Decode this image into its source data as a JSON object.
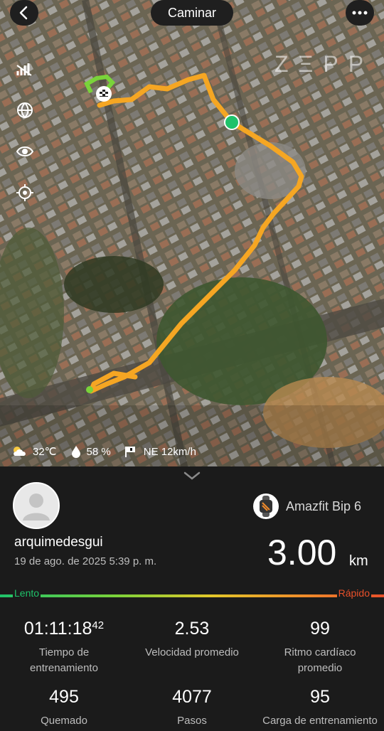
{
  "header": {
    "title": "Caminar",
    "back_icon": "chevron-left-icon",
    "more_icon": "more-dots-icon"
  },
  "map": {
    "watermark": "ZΞPP",
    "side_tools": [
      "signal-off-icon",
      "globe-icon",
      "eye-icon",
      "locate-icon"
    ],
    "route_color": "#f5a623",
    "weather": {
      "temperature": "32℃",
      "humidity": "58 %",
      "wind": "NE 12km/h"
    }
  },
  "summary": {
    "username": "arquimedesgui",
    "date": "19 de ago. de 2025 5:39 p. m.",
    "device": "Amazfit Bip 6",
    "distance_value": "3.00",
    "distance_unit": "km",
    "pace_scale": {
      "slow": "Lento",
      "fast": "Rápido"
    }
  },
  "stats": [
    {
      "value": "01:11:18",
      "value_sup": "42",
      "label": "Tiempo de entrenamiento"
    },
    {
      "value": "2.53",
      "label": "Velocidad promedio"
    },
    {
      "value": "99",
      "label": "Ritmo cardíaco promedio"
    },
    {
      "value": "495",
      "label": "Quemado"
    },
    {
      "value": "4077",
      "label": "Pasos"
    },
    {
      "value": "95",
      "label": "Carga de entrenamiento"
    }
  ]
}
